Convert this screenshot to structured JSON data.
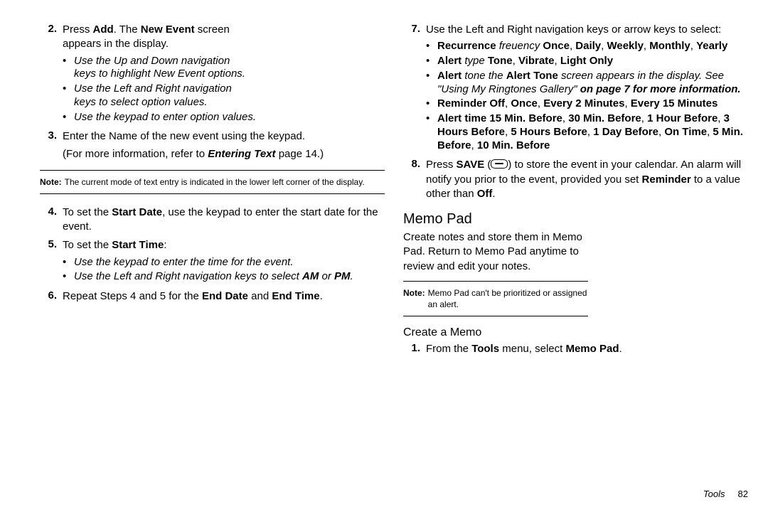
{
  "left": {
    "step2": {
      "num": "2.",
      "t1a": "Press ",
      "t1b": "Add",
      "t1c": ". The ",
      "t1d": "New Event",
      "t1e": " screen appears in the display.",
      "b1": "Use the Up and Down navigation keys to highlight New Event options.",
      "b2": "Use the Left and Right navigation keys to select option values.",
      "b3": "Use the keypad to enter option values."
    },
    "step3": {
      "num": "3.",
      "t1": "Enter the Name of the new event using the keypad.",
      "t2a": "(For more information, refer to ",
      "t2b": "Entering Text",
      "t2c": " page 14.)"
    },
    "note1": {
      "label": "Note:",
      "text": "The current mode of text entry is indicated in the lower left corner of the display."
    },
    "step4": {
      "num": "4.",
      "t1a": "To set the ",
      "t1b": "Start Date",
      "t1c": ", use the keypad to enter the start date for the event."
    },
    "step5": {
      "num": "5.",
      "t1a": "To set the ",
      "t1b": "Start Time",
      "t1c": ":",
      "b1": "Use the keypad to enter the time for the event.",
      "b2a": "Use the Left and Right navigation keys to select ",
      "b2b": "AM",
      "b2c": " or ",
      "b2d": "PM",
      "b2e": "."
    },
    "step6": {
      "num": "6.",
      "t1a": "Repeat Steps 4 and 5 for the ",
      "t1b": "End Date",
      "t1c": " and ",
      "t1d": "End Time",
      "t1e": "."
    }
  },
  "right": {
    "step7": {
      "num": "7.",
      "t1": "Use the Left and Right navigation keys or arrow keys to select:",
      "b1": {
        "a": "Recurrence",
        "b": " freuency ",
        "c": "Once",
        "d": ", ",
        "e": "Daily",
        "f": ", ",
        "g": "Weekly",
        "h": ", ",
        "i": "Monthly",
        "j": ", ",
        "k": "Yearly"
      },
      "b2": {
        "a": "Alert",
        "b": " type ",
        "c": "Tone",
        "d": ", ",
        "e": "Vibrate",
        "f": ", ",
        "g": "Light Only"
      },
      "b3": {
        "a": "Alert",
        "b": " tone the ",
        "c": "Alert Tone",
        "d": " screen appears in the display. See \"Using My Ringtones Gallery\" ",
        "e": "on page 7 for more information."
      },
      "b4": {
        "a": "Reminder ",
        "b": "Off",
        "c": ", ",
        "d": "Once",
        "e": ", ",
        "f": "Every 2 Minutes",
        "g": ", ",
        "h": "Every 15 Minutes"
      },
      "b5": {
        "a": "Alert time ",
        "b": "15 Min. Before",
        "c": ", ",
        "d": "30 Min. Before",
        "e": ", ",
        "f": "1 Hour Before",
        "g": ", ",
        "h": "3 Hours Before",
        "i": ", ",
        "j": "5 Hours Before",
        "k": ", ",
        "l": "1 Day Before",
        "m": ", ",
        "n": "On Time",
        "o": ", ",
        "p": "5 Min. Before",
        "q": ", ",
        "r": "10 Min. Before"
      }
    },
    "step8": {
      "num": "8.",
      "t1a": "Press ",
      "t1b": "SAVE",
      "t1c": " (",
      "t1d": ") to store the event in your calendar. An alarm will notify you prior to the event, provided you set ",
      "t1e": "Reminder",
      "t1f": " to a value other than ",
      "t1g": "Off",
      "t1h": "."
    },
    "section": "Memo Pad",
    "intro": "Create notes and store them in Memo Pad. Return to Memo Pad anytime to review and edit your notes.",
    "note2": {
      "label": "Note:",
      "text": "Memo Pad can't be prioritized or assigned an alert."
    },
    "subhead": "Create a Memo",
    "step1": {
      "num": "1.",
      "t1a": "From the ",
      "t1b": "Tools",
      "t1c": " menu, select ",
      "t1d": "Memo Pad",
      "t1e": "."
    }
  },
  "footer": {
    "section": "Tools",
    "page": "82"
  }
}
